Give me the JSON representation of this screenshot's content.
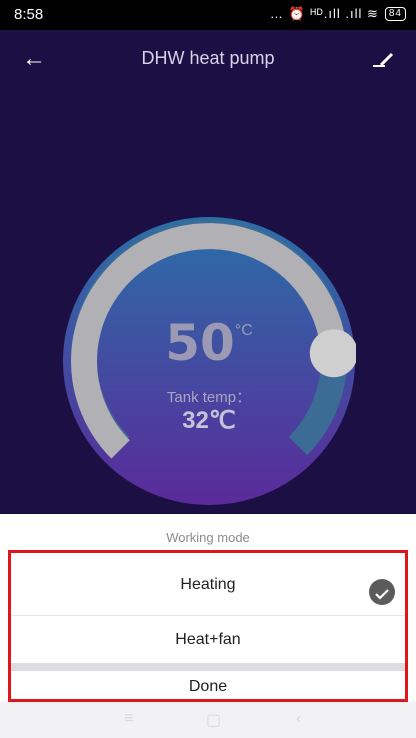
{
  "status_bar": {
    "time": "8:58",
    "icons": "… ⏰ ᴴᴰ.ıll .ıll ≋",
    "battery": "84"
  },
  "header": {
    "title": "DHW heat pump"
  },
  "dial": {
    "setpoint": "50",
    "unit": "°C",
    "tank_label": "Tank temp：",
    "tank_value": "32℃",
    "level": 0.82
  },
  "colors": {
    "screen_bg": "#1b0f43",
    "dial_top": "#2a6fa8",
    "dial_bottom": "#5a2a9a",
    "highlight": "#e0161b"
  },
  "sheet": {
    "title": "Working mode",
    "options": [
      {
        "label": "Heating",
        "selected": true
      },
      {
        "label": "Heat+fan",
        "selected": false
      }
    ],
    "done_label": "Done"
  },
  "nav": {
    "menu_icon": "menu-icon",
    "home_icon": "home-icon",
    "back_icon": "back-nav-icon"
  }
}
